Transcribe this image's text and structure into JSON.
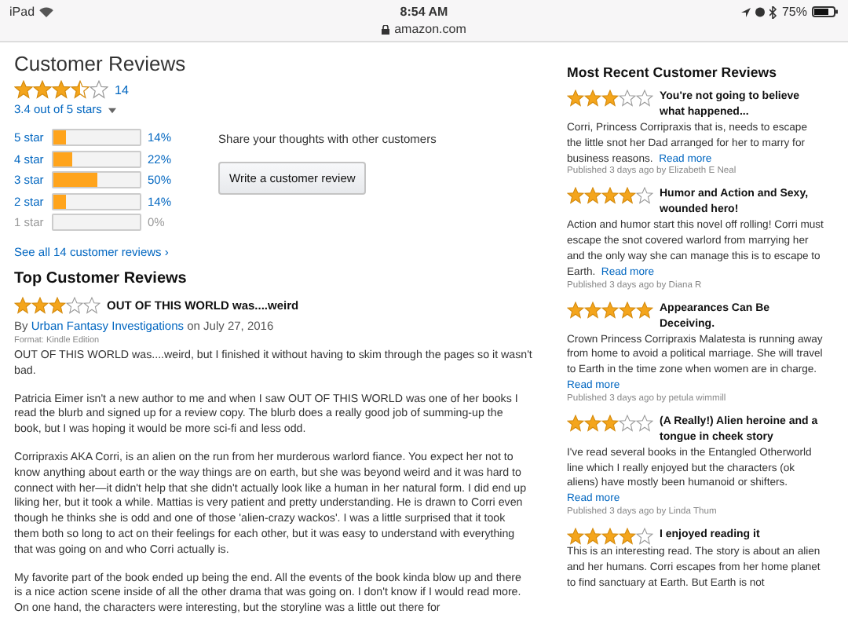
{
  "status_bar": {
    "device": "iPad",
    "time": "8:54 AM",
    "battery": "75%"
  },
  "address_bar": {
    "url": "amazon.com"
  },
  "customer_reviews": {
    "title": "Customer Reviews",
    "stars": 3.5,
    "count": "14",
    "average": "3.4 out of 5 stars",
    "histogram": [
      {
        "label": "5 star",
        "level": 0.14,
        "percent": "14%",
        "disabled": false
      },
      {
        "label": "4 star",
        "level": 0.22,
        "percent": "22%",
        "disabled": false
      },
      {
        "label": "3 star",
        "level": 0.5,
        "percent": "50%",
        "disabled": false
      },
      {
        "label": "2 star",
        "level": 0.14,
        "percent": "14%",
        "disabled": false
      },
      {
        "label": "1 star",
        "level": 0,
        "percent": "0%",
        "disabled": true
      }
    ],
    "share_text": "Share your thoughts with other customers",
    "write_button": "Write a customer review",
    "see_all": "See all 14 customer reviews ›"
  },
  "top_reviews": {
    "title": "Top Customer Reviews",
    "reviews": [
      {
        "stars": 3,
        "title": "OUT OF THIS WORLD was....weird",
        "by": "By",
        "author": "Urban Fantasy Investigations",
        "date": "on July 27, 2016",
        "format": "Format: Kindle Edition",
        "paragraphs": [
          "OUT OF THIS WORLD was....weird, but I finished it without having to skim through the pages so it wasn't bad.",
          "Patricia Eimer isn't a new author to me and when I saw OUT OF THIS WORLD was one of her books I read the blurb and signed up for a review copy. The blurb does a really good job of summing-up the book, but I was hoping it would be more sci-fi and less odd.",
          "Corripraxis AKA Corri, is an alien on the run from her murderous warlord fiance. You expect her not to know anything about earth or the way things are on earth, but she was beyond weird and it was hard to connect with her—it didn't help that she didn't actually look like a human in her natural form. I did end up liking her, but it took a while. Mattias is very patient and pretty understanding. He is drawn to Corri even though he thinks she is odd and one of those 'alien-crazy wackos'. I was a little surprised that it took them both so long to act on their feelings for each other, but it was easy to understand with everything that was going on and who Corri actually is.",
          "My favorite part of the book ended up being the end. All the events of the book kinda blow up and there is a nice action scene inside of all the other drama that was going on. I don't know if I would read more. On one hand, the characters were interesting, but the storyline was a little out there for"
        ]
      }
    ]
  },
  "recent_reviews": {
    "title": "Most Recent Customer Reviews",
    "reviews": [
      {
        "stars": 3,
        "title": "You're not going to believe what happened...",
        "body": "Corri, Princess Corripraxis that is, needs to escape the little snot her Dad arranged for her to marry for business reasons.",
        "read_more": "Read more",
        "meta": "Published 3 days ago by Elizabeth E Neal"
      },
      {
        "stars": 4,
        "title": "Humor and Action and Sexy, wounded hero!",
        "body": "Action and humor start this novel off rolling! Corri must escape the snot covered warlord from marrying her and the only way she can manage this is to escape to Earth.",
        "read_more": "Read more",
        "meta": "Published 3 days ago by Diana R"
      },
      {
        "stars": 5,
        "title": "Appearances Can Be Deceiving.",
        "body": "Crown Princess Corripraxis Malatesta is running away from home to avoid a political marriage. She will travel to Earth in the time zone when women are in charge.",
        "read_more": "Read more",
        "meta": "Published 3 days ago by petula wimmill"
      },
      {
        "stars": 3,
        "title": "(A Really!) Alien heroine and a tongue in cheek story",
        "body": "I've read several books in the Entangled Otherworld line which I really enjoyed but the characters (ok aliens) have mostly been humanoid or shifters.",
        "read_more": "Read more",
        "meta": "Published 3 days ago by Linda Thum"
      },
      {
        "stars": 4,
        "title": "I enjoyed reading it",
        "body": "This is an interesting read. The story is about an alien and her humans. Corri escapes from her home planet to find sanctuary at Earth. But Earth is not"
      }
    ]
  }
}
